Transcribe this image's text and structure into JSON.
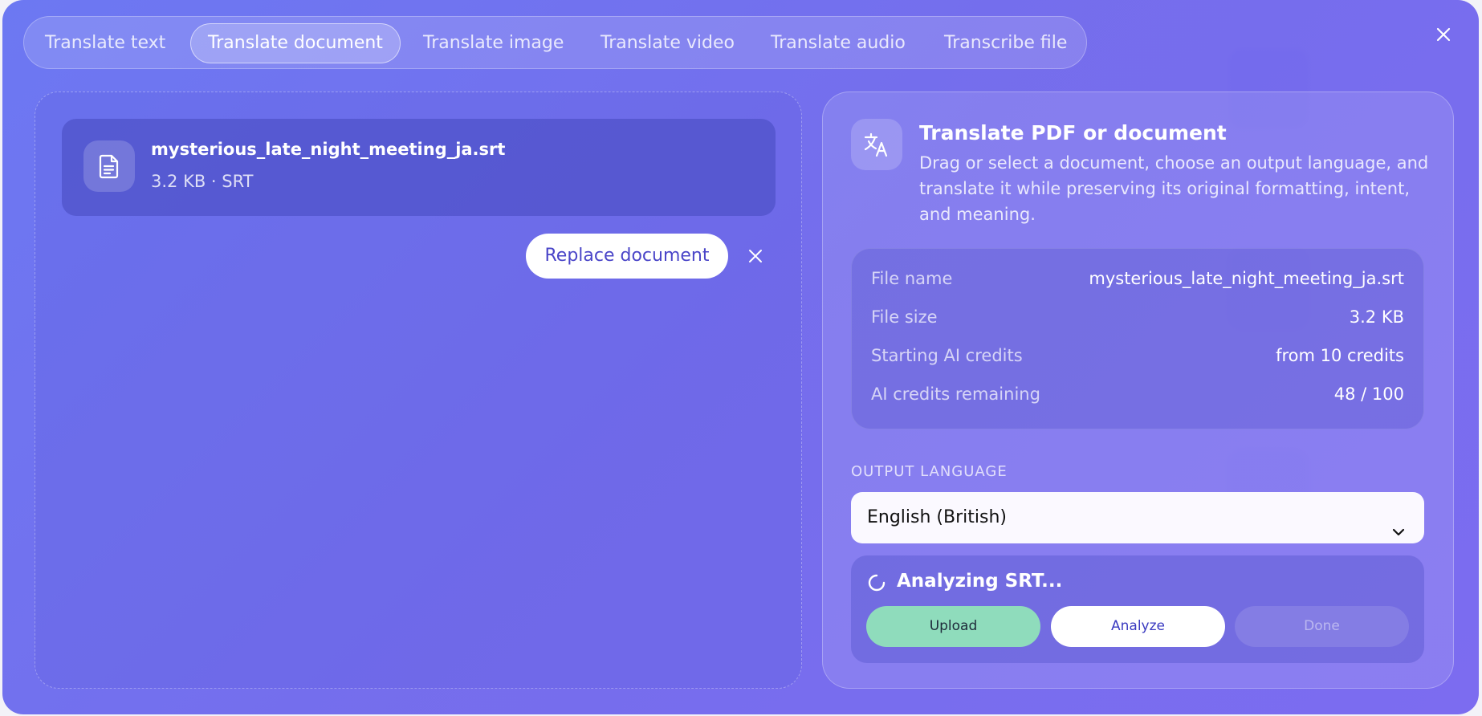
{
  "tabs": [
    {
      "label": "Translate text",
      "active": false
    },
    {
      "label": "Translate document",
      "active": true
    },
    {
      "label": "Translate image",
      "active": false
    },
    {
      "label": "Translate video",
      "active": false
    },
    {
      "label": "Translate audio",
      "active": false
    },
    {
      "label": "Transcribe file",
      "active": false
    }
  ],
  "close_icon": "close-icon",
  "file_card": {
    "name": "mysterious_late_night_meeting_ja.srt",
    "meta": "3.2 KB · SRT",
    "icon": "document-icon"
  },
  "replace_button": "Replace document",
  "panel": {
    "title": "Translate PDF or document",
    "description": "Drag or select a document, choose an output language, and translate it while preserving its original formatting, intent, and meaning.",
    "icon": "translate-icon",
    "info": [
      {
        "label": "File name",
        "value": "mysterious_late_night_meeting_ja.srt"
      },
      {
        "label": "File size",
        "value": "3.2 KB"
      },
      {
        "label": "Starting AI credits",
        "value": "from 10 credits"
      },
      {
        "label": "AI credits remaining",
        "value": "48 / 100"
      }
    ],
    "output_language_label": "OUTPUT LANGUAGE",
    "output_language": "English (British)",
    "status": {
      "text": "Analyzing SRT...",
      "buttons": {
        "upload": "Upload",
        "analyze": "Analyze",
        "done": "Done"
      }
    }
  },
  "colors": {
    "accent": "#4a45c8",
    "upload": "#8fdcbc",
    "modal_bg": "#6e72ee"
  }
}
